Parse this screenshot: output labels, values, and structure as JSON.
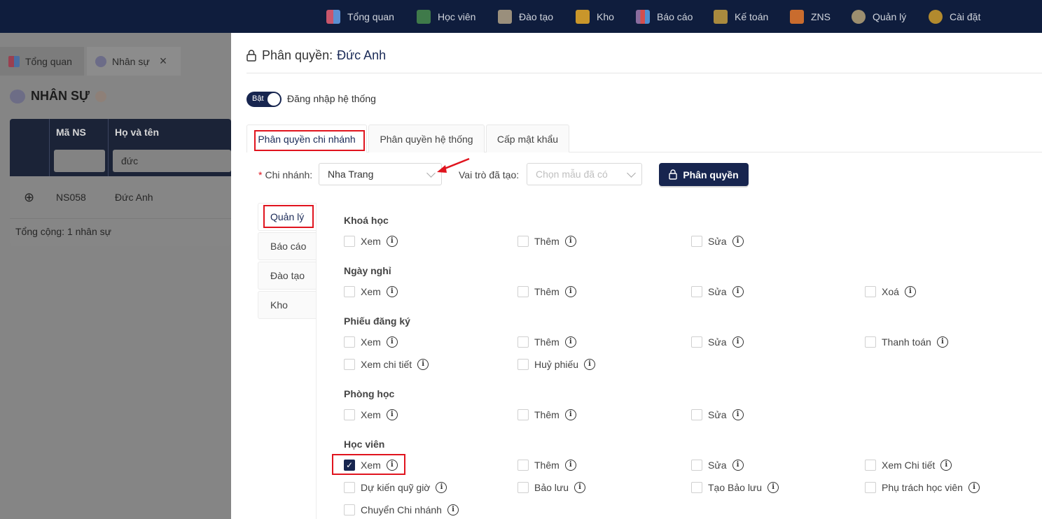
{
  "nav": {
    "items": [
      {
        "label": "Tổng quan",
        "icon": "grid-icon",
        "color": "#c9566b"
      },
      {
        "label": "Học viên",
        "icon": "graduation-cap-icon",
        "color": "#3f7a4a"
      },
      {
        "label": "Đào tạo",
        "icon": "pencil-book-icon",
        "color": "#9a8f7c"
      },
      {
        "label": "Kho",
        "icon": "box-icon",
        "color": "#c9962b"
      },
      {
        "label": "Báo cáo",
        "icon": "bar-chart-icon",
        "color": "#8a6c9e"
      },
      {
        "label": "Kế toán",
        "icon": "ledger-icon",
        "color": "#a98a3e"
      },
      {
        "label": "ZNS",
        "icon": "mail-icon",
        "color": "#c96c2e"
      },
      {
        "label": "Quản lý",
        "icon": "gear-people-icon",
        "color": "#9c8e6f"
      },
      {
        "label": "Cài đặt",
        "icon": "gear-icon",
        "color": "#b28a2e"
      }
    ]
  },
  "bg": {
    "tabs": [
      {
        "label": "Tổng quan"
      },
      {
        "label": "Nhân sự",
        "close": "×"
      }
    ],
    "page_title": "NHÂN SỰ",
    "table": {
      "headers": [
        "Mã NS",
        "Họ và tên"
      ],
      "filter_value": "đức",
      "row": {
        "code": "NS058",
        "name": "Đức Anh",
        "expand": "⊕"
      },
      "footer": "Tổng cộng: 1 nhân sự"
    }
  },
  "drawer": {
    "title_prefix": "Phân quyền:",
    "title_name": "Đức Anh",
    "toggle_label": "Bật",
    "toggle_text": "Đăng nhập hệ thống",
    "tabs": [
      "Phân quyền chi nhánh",
      "Phân quyền hệ thống",
      "Cấp mật khẩu"
    ],
    "branch_label": "Chi nhánh:",
    "branch_required": "*",
    "branch_value": "Nha Trang",
    "role_label": "Vai trò đã tạo:",
    "role_placeholder": "Chọn mẫu đã có",
    "permission_button": "Phân quyền",
    "side_tabs": [
      "Quản lý",
      "Báo cáo",
      "Đào tạo",
      "Kho"
    ],
    "groups": [
      {
        "title": "Khoá học",
        "perms": [
          {
            "label": "Xem",
            "checked": false
          },
          {
            "label": "Thêm",
            "checked": false
          },
          {
            "label": "Sửa",
            "checked": false
          }
        ]
      },
      {
        "title": "Ngày nghỉ",
        "perms": [
          {
            "label": "Xem",
            "checked": false
          },
          {
            "label": "Thêm",
            "checked": false
          },
          {
            "label": "Sửa",
            "checked": false
          },
          {
            "label": "Xoá",
            "checked": false
          }
        ]
      },
      {
        "title": "Phiếu đăng ký",
        "perms": [
          {
            "label": "Xem",
            "checked": false
          },
          {
            "label": "Thêm",
            "checked": false
          },
          {
            "label": "Sửa",
            "checked": false
          },
          {
            "label": "Thanh toán",
            "checked": false
          },
          {
            "label": "Xem chi tiết",
            "checked": false
          },
          {
            "label": "Huỷ phiếu",
            "checked": false
          }
        ]
      },
      {
        "title": "Phòng học",
        "perms": [
          {
            "label": "Xem",
            "checked": false
          },
          {
            "label": "Thêm",
            "checked": false
          },
          {
            "label": "Sửa",
            "checked": false
          }
        ]
      },
      {
        "title": "Học viên",
        "perms": [
          {
            "label": "Xem",
            "checked": true
          },
          {
            "label": "Thêm",
            "checked": false
          },
          {
            "label": "Sửa",
            "checked": false
          },
          {
            "label": "Xem Chi tiết",
            "checked": false
          },
          {
            "label": "Dự kiến quỹ giờ",
            "checked": false
          },
          {
            "label": "Bảo lưu",
            "checked": false
          },
          {
            "label": "Tạo Bảo lưu",
            "checked": false
          },
          {
            "label": "Phụ trách học viên",
            "checked": false
          },
          {
            "label": "Chuyển Chi nhánh",
            "checked": false
          }
        ]
      }
    ],
    "info_glyph": "i",
    "check_glyph": "✓"
  },
  "colors": {
    "primary": "#17254f",
    "nav_bg": "#0f1d3d",
    "highlight": "#e0141e"
  }
}
